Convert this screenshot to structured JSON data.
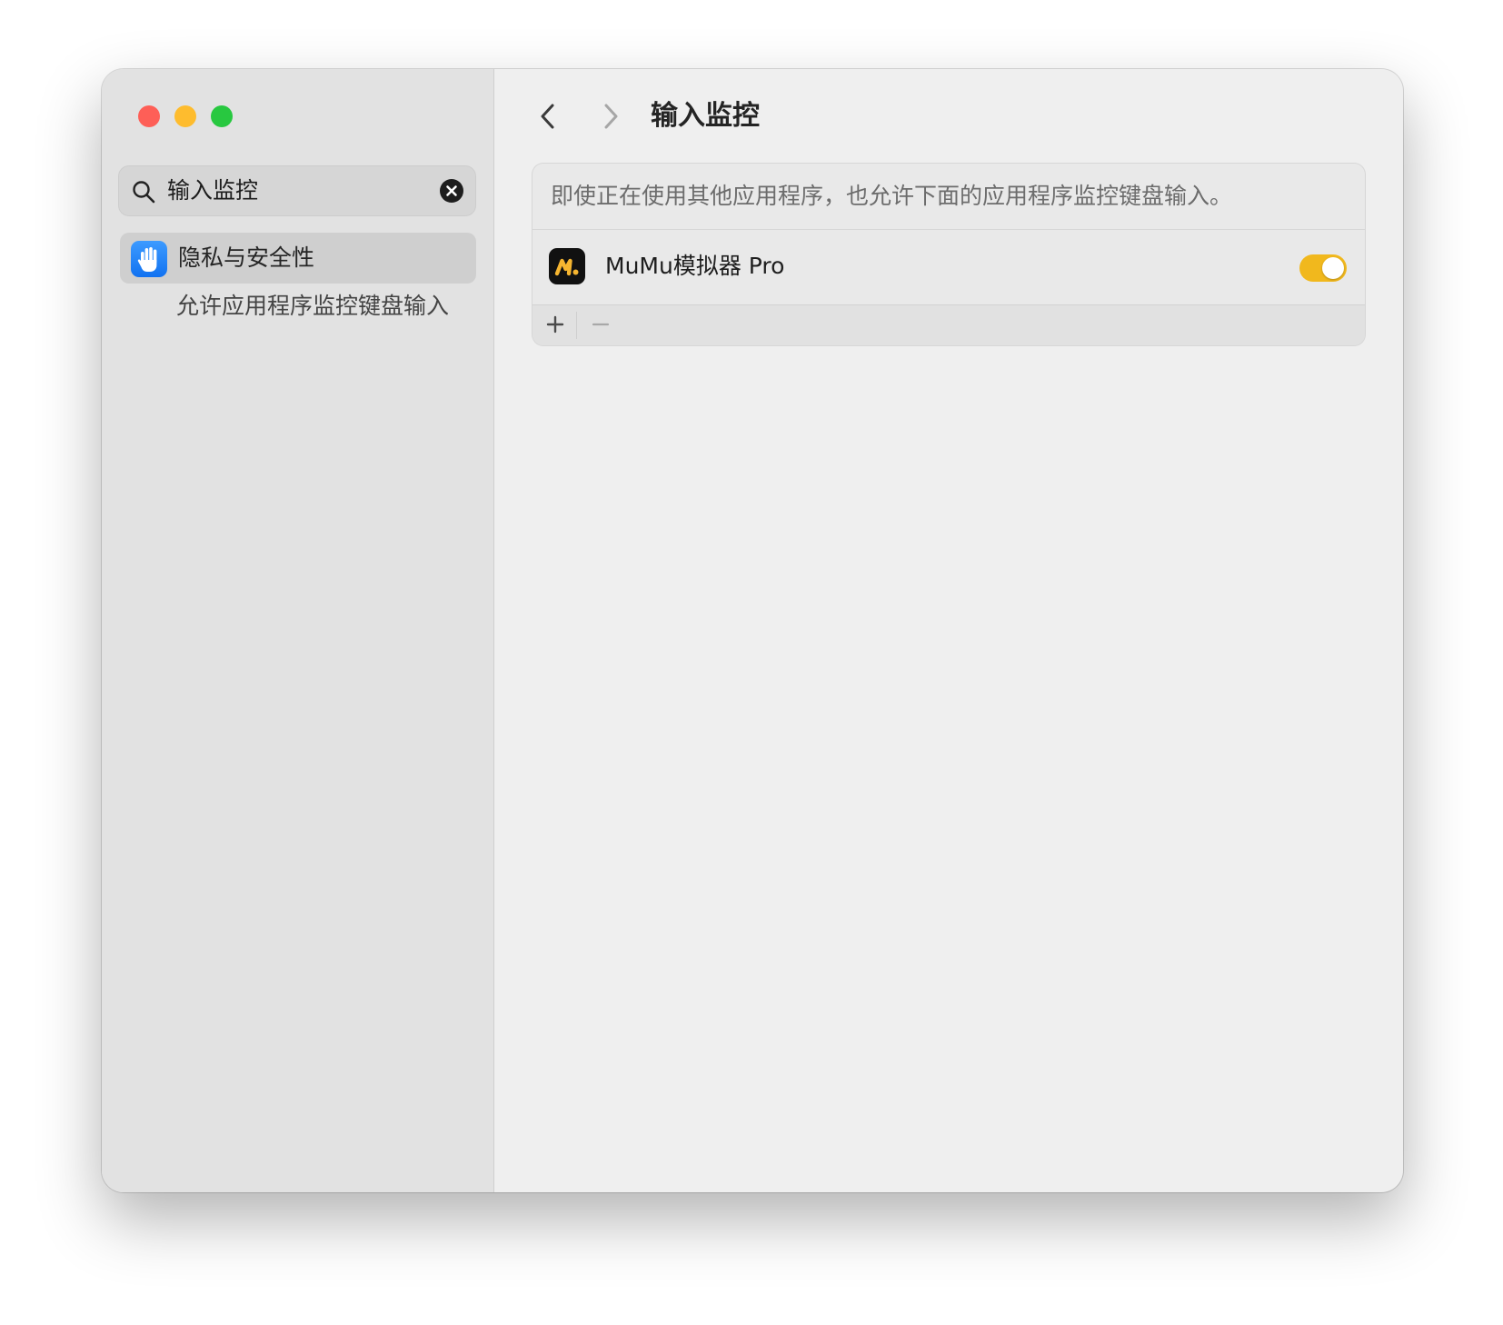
{
  "window": {
    "controls": [
      "close",
      "minimize",
      "zoom"
    ]
  },
  "sidebar": {
    "search": {
      "value": "输入监控",
      "icon": "magnifyingglass-icon",
      "clear_icon": "xmark-circle-fill-icon"
    },
    "selected_item": {
      "label": "隐私与安全性",
      "icon": "hand-raised-icon",
      "icon_color": "#1a7ff5"
    },
    "sub_result": "允许应用程序监控键盘输入"
  },
  "main": {
    "title": "输入监控",
    "nav": {
      "back_icon": "chevron-left-icon",
      "forward_icon": "chevron-right-icon"
    },
    "description": "即使正在使用其他应用程序，也允许下面的应用程序监控键盘输入。",
    "apps": [
      {
        "name": "MuMu模拟器 Pro",
        "icon": "mumu-app-icon",
        "enabled": true,
        "toggle_color": "#f1b81d"
      }
    ],
    "toolbar": {
      "add_icon": "plus-icon",
      "remove_icon": "minus-icon"
    }
  },
  "colors": {
    "close": "#fe5f57",
    "minimize": "#febc2e",
    "zoom": "#28c840",
    "accent": "#f1b81d"
  }
}
